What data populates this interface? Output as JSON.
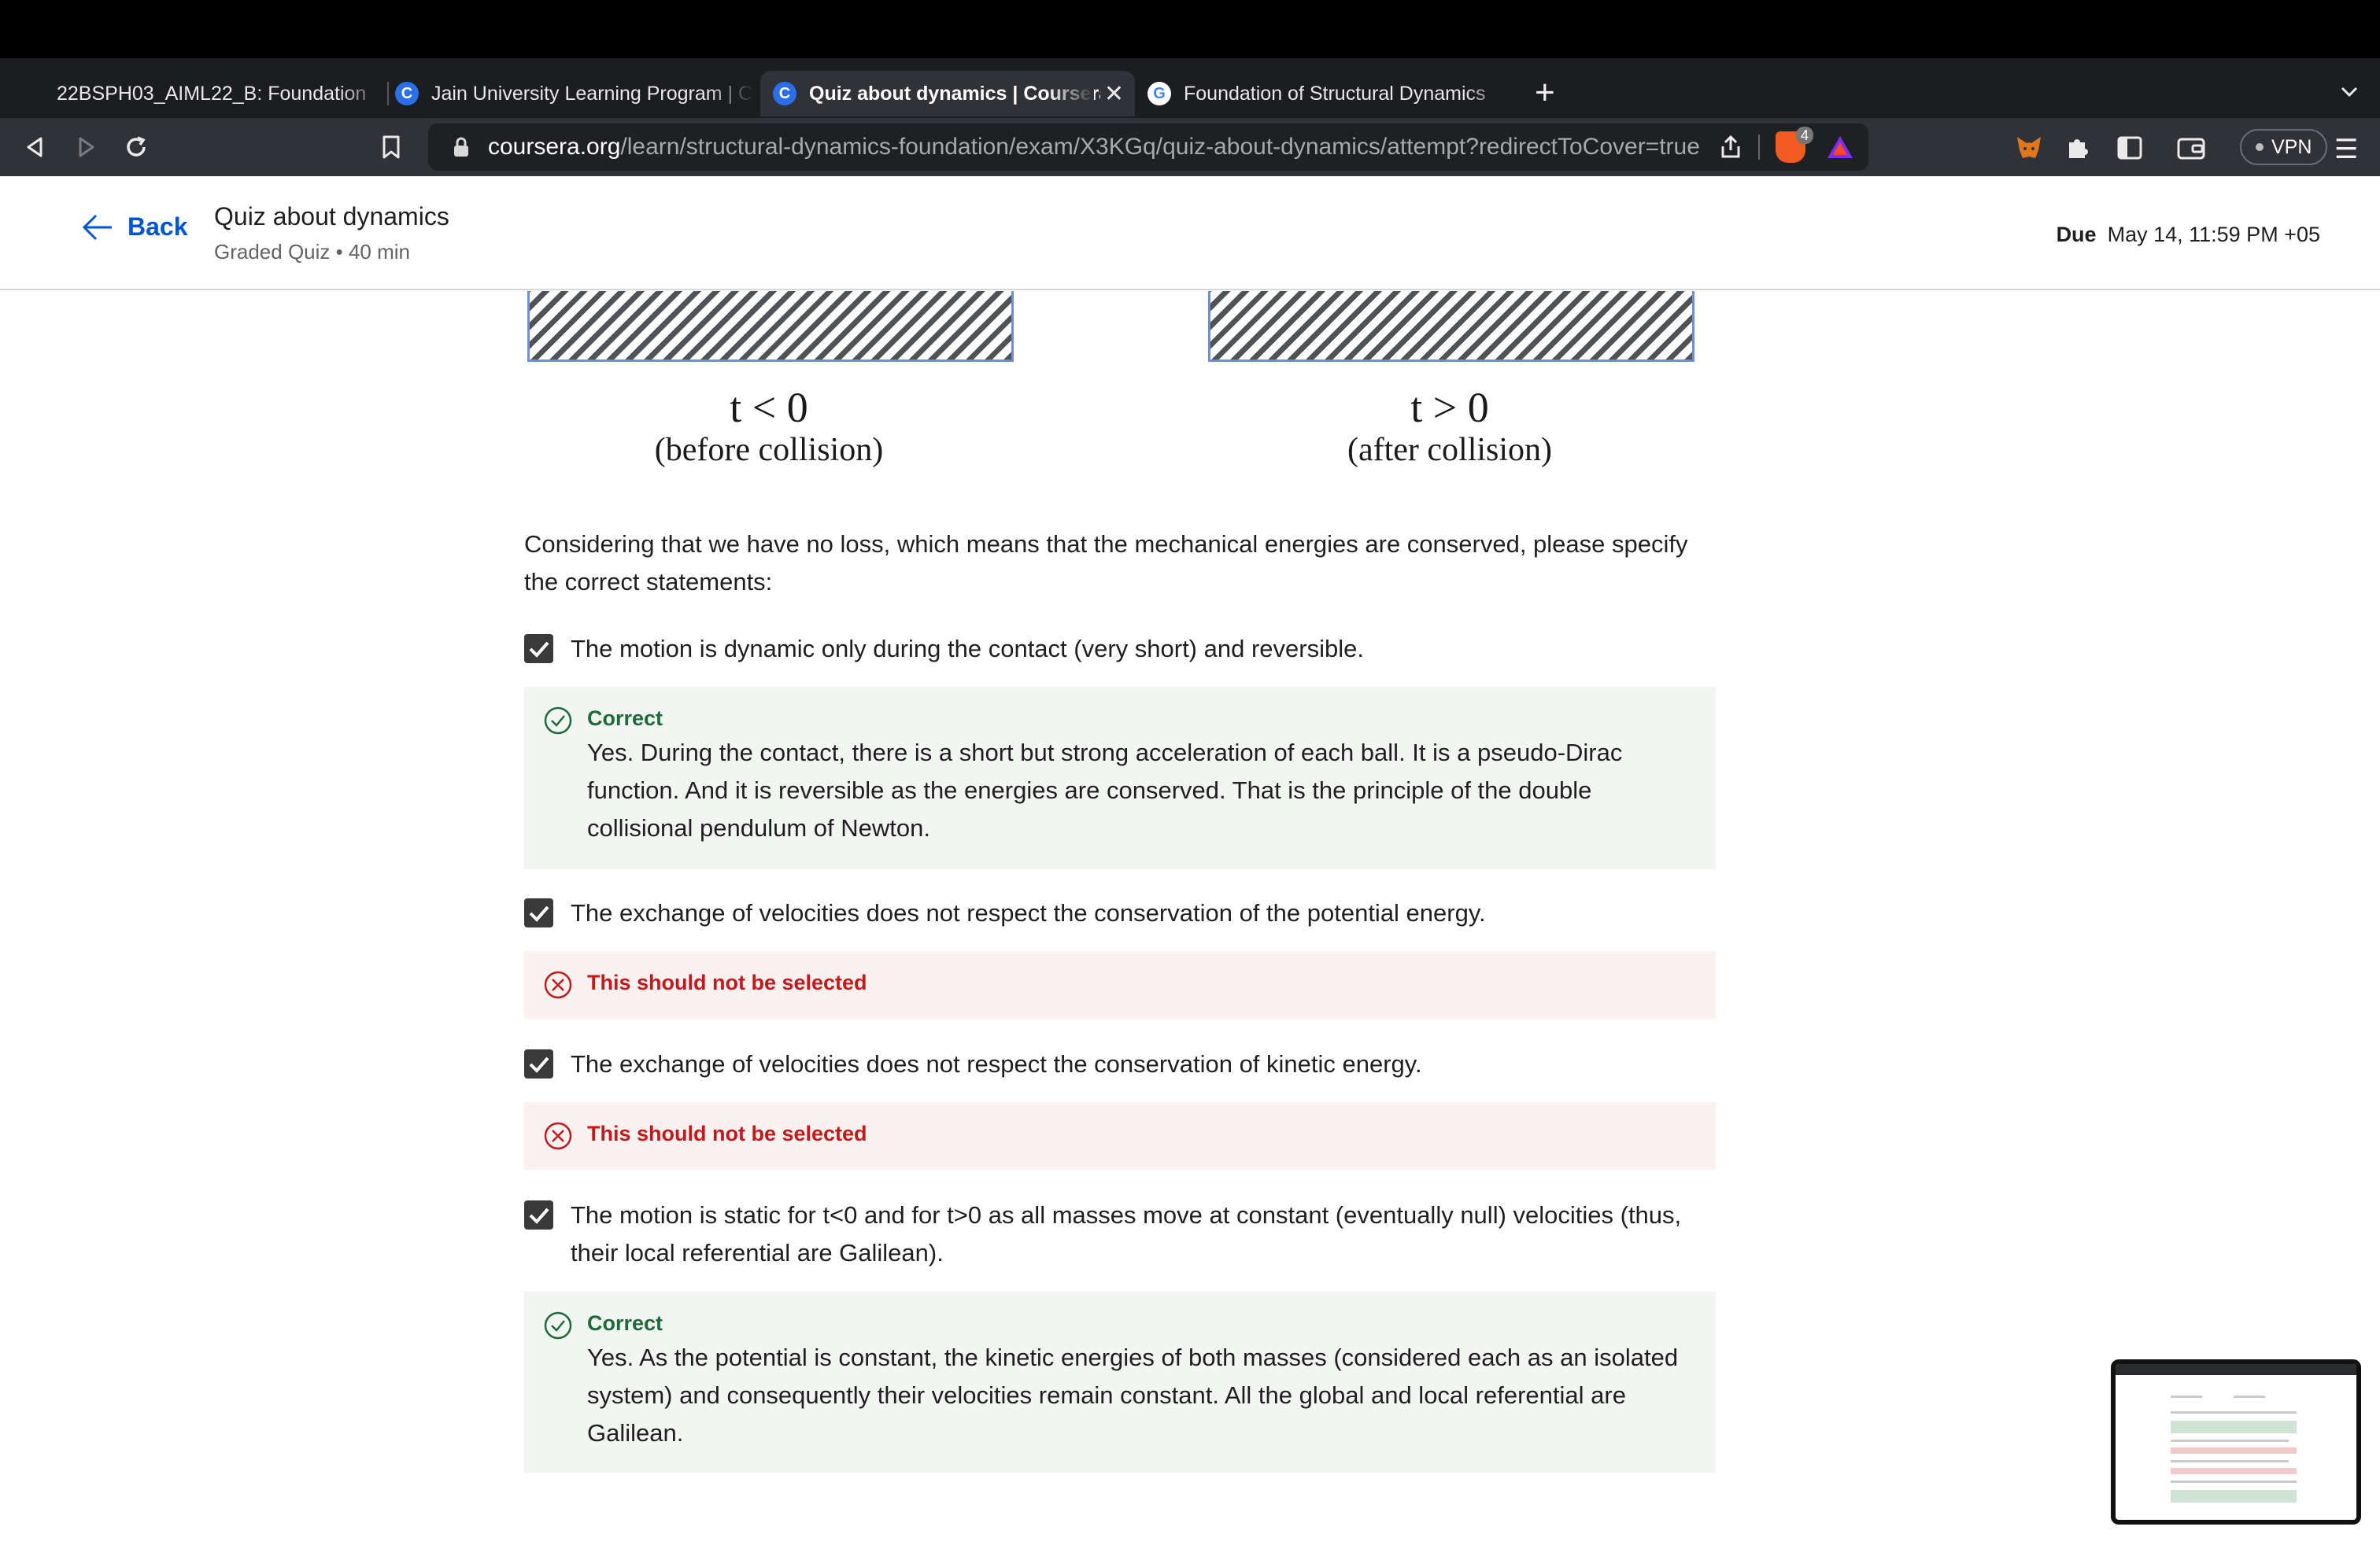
{
  "browser": {
    "tabs": [
      {
        "title": "22BSPH03_AIML22_B: Foundation",
        "favicon": "shield-icon",
        "active": false
      },
      {
        "title": "Jain University Learning Program | C",
        "favicon": "coursera-icon",
        "active": false
      },
      {
        "title": "Quiz about dynamics | Coursera",
        "favicon": "coursera-icon",
        "active": true
      },
      {
        "title": "Foundation of Structural Dynamics",
        "favicon": "google-icon",
        "active": false
      }
    ],
    "new_tab": "+",
    "url_host": "coursera.org",
    "url_path": "/learn/structural-dynamics-foundation/exam/X3KGq/quiz-about-dynamics/attempt?redirectToCover=true",
    "shield_count": "4",
    "vpn_label": "VPN",
    "menu_glyph": "☰"
  },
  "header": {
    "back_label": "Back",
    "title": "Quiz about dynamics",
    "subtitle": "Graded Quiz • 40 min",
    "due_label": "Due",
    "due_value": "May 14, 11:59 PM +05"
  },
  "figure": {
    "left_time": "t < 0",
    "left_caption": "(before collision)",
    "right_time": "t > 0",
    "right_caption": "(after collision)"
  },
  "question": {
    "text": "Considering that we have no loss, which means that the mechanical energies are conserved, please specify the correct statements:"
  },
  "options": [
    {
      "text": "The motion is dynamic only during the contact (very short) and reversible.",
      "checked": true,
      "feedback_title": "Correct",
      "feedback_body": "Yes. During the contact, there is a short but strong acceleration of each ball. It is a pseudo-Dirac function. And it is reversible as the energies are conserved. That is the principle of the double collisional pendulum of Newton."
    },
    {
      "text": "The exchange of velocities does not respect the conservation of the potential energy.",
      "checked": true,
      "feedback_title": "This should not be selected"
    },
    {
      "text": "The exchange of velocities does not respect the conservation of kinetic energy.",
      "checked": true,
      "feedback_title": "This should not be selected"
    },
    {
      "text": "The motion is static for t<0 and for t>0 as all masses move at constant (eventually null) velocities (thus, their local referential are Galilean).",
      "checked": true,
      "feedback_title": "Correct",
      "feedback_body": "Yes. As the potential is constant, the kinetic energies of both masses (considered each as an isolated system) and consequently their velocities remain constant. All the global and local referential are Galilean."
    }
  ],
  "colors": {
    "accent": "#0056d2",
    "correct": "#1e6b3a",
    "wrong": "#c01a1a",
    "correct_bg": "#f2f5f2",
    "wrong_bg": "#fbf1f1"
  }
}
